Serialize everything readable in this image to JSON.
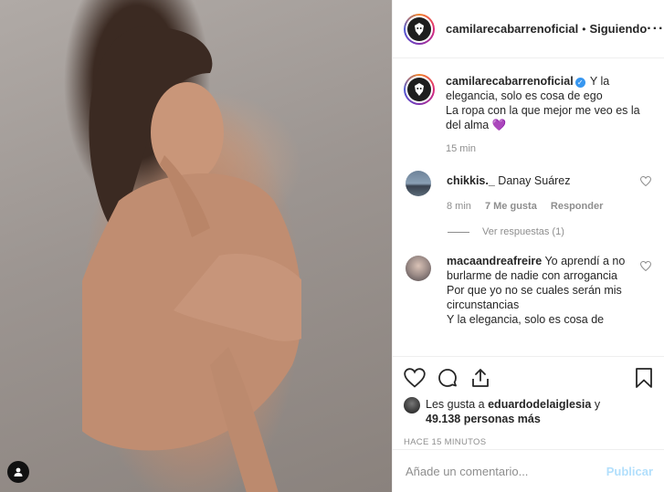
{
  "header": {
    "username": "camilarecabarrenoficial",
    "separator": "•",
    "follow_status": "Siguiendo",
    "more_icon": "more-horizontal-icon"
  },
  "caption": {
    "username": "camilarecabarrenoficial",
    "verified_icon": "verified-badge-icon",
    "text_line1": " Y la elegancia, solo es cosa de ego",
    "text_line2": "La ropa con la que mejor me veo es la del alma ",
    "emoji": "💜",
    "time": "15 min"
  },
  "comments": [
    {
      "username": "chikkis._",
      "text": " Danay Suárez",
      "time": "8 min",
      "likes": "7 Me gusta",
      "reply_label": "Responder",
      "view_replies": "Ver respuestas (1)"
    },
    {
      "username": "macaandreafreire",
      "text": " Yo aprendí a no burlarme de nadie con arrogancia",
      "line2": "Por que yo no se cuales serán mis circunstancias",
      "line3": "Y la elegancia, solo es cosa de"
    }
  ],
  "likes": {
    "prefix": "Les gusta a ",
    "user": "eduardodelaiglesia",
    "middle": " y ",
    "count": "49.138 personas más"
  },
  "timestamp": "HACE 15 MINUTOS",
  "add_comment": {
    "placeholder": "Añade un comentario...",
    "publish_label": "Publicar"
  },
  "colors": {
    "verified": "#3897f0",
    "publish_disabled": "#b2dffc",
    "muted_text": "#8e8e8e"
  }
}
